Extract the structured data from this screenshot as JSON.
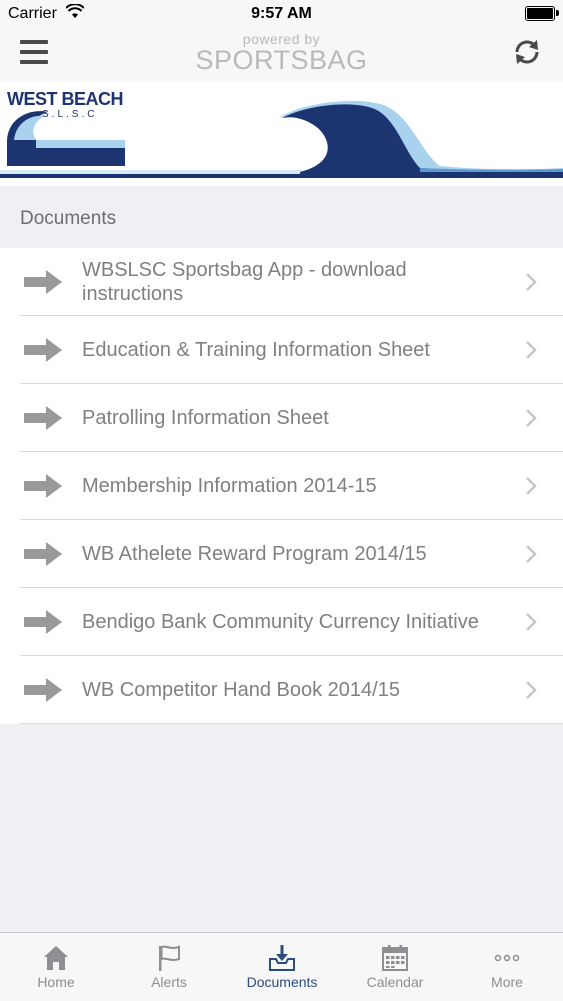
{
  "status_bar": {
    "carrier": "Carrier",
    "time": "9:57 AM"
  },
  "nav": {
    "powered_by": "powered by",
    "brand": "SPORTSBAG"
  },
  "banner": {
    "logo_title": "WEST BEACH",
    "logo_subtitle": "S.L.S.C"
  },
  "section": {
    "title": "Documents"
  },
  "documents": [
    {
      "label": "WBSLSC Sportsbag App - download instructions"
    },
    {
      "label": "Education & Training Information Sheet"
    },
    {
      "label": "Patrolling Information Sheet"
    },
    {
      "label": "Membership Information 2014-15"
    },
    {
      "label": "WB Athelete Reward Program 2014/15"
    },
    {
      "label": "Bendigo Bank Community Currency Initiative"
    },
    {
      "label": "WB Competitor Hand Book 2014/15"
    }
  ],
  "tabs": [
    {
      "label": "Home",
      "icon": "home-icon"
    },
    {
      "label": "Alerts",
      "icon": "flag-icon"
    },
    {
      "label": "Documents",
      "icon": "inbox-download-icon",
      "active": true
    },
    {
      "label": "Calendar",
      "icon": "calendar-icon"
    },
    {
      "label": "More",
      "icon": "more-dots-icon"
    }
  ],
  "colors": {
    "accent": "#2b4c7e",
    "wave_dark": "#1c3470",
    "wave_light": "#a8d2ee",
    "text_gray": "#808080"
  }
}
